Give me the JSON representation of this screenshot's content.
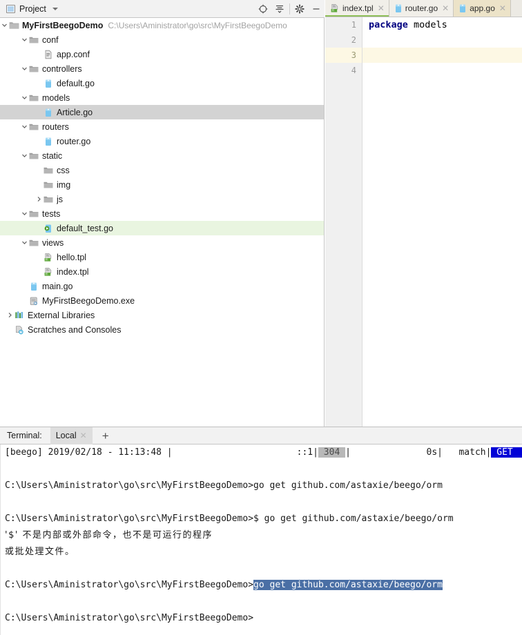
{
  "tool_window": {
    "title": "Project",
    "dropdown_icon": "chevron-down-icon",
    "actions": [
      {
        "name": "locate-target-icon",
        "label": "Select Opened File"
      },
      {
        "name": "collapse-all-icon",
        "label": "Collapse All"
      },
      {
        "name": "settings-gear-icon",
        "label": "Settings"
      },
      {
        "name": "minimize-icon",
        "label": "Hide"
      }
    ]
  },
  "tree": {
    "root_label": "MyFirstBeegoDemo",
    "root_path": "C:\\Users\\Aministrator\\go\\src\\MyFirstBeegoDemo",
    "nodes": [
      {
        "label": "conf",
        "indent": 1,
        "arrow": "expanded",
        "icon": "folder-icon",
        "state": "none"
      },
      {
        "label": "app.conf",
        "indent": 2,
        "arrow": "none",
        "icon": "config-file-icon",
        "state": "none"
      },
      {
        "label": "controllers",
        "indent": 1,
        "arrow": "expanded",
        "icon": "folder-icon",
        "state": "none"
      },
      {
        "label": "default.go",
        "indent": 2,
        "arrow": "none",
        "icon": "go-file-icon",
        "state": "none"
      },
      {
        "label": "models",
        "indent": 1,
        "arrow": "expanded",
        "icon": "folder-icon",
        "state": "none"
      },
      {
        "label": "Article.go",
        "indent": 2,
        "arrow": "none",
        "icon": "go-file-icon",
        "state": "selected"
      },
      {
        "label": "routers",
        "indent": 1,
        "arrow": "expanded",
        "icon": "folder-icon",
        "state": "none"
      },
      {
        "label": "router.go",
        "indent": 2,
        "arrow": "none",
        "icon": "go-file-icon",
        "state": "none"
      },
      {
        "label": "static",
        "indent": 1,
        "arrow": "expanded",
        "icon": "folder-icon",
        "state": "none"
      },
      {
        "label": "css",
        "indent": 2,
        "arrow": "none",
        "icon": "folder-icon",
        "state": "none"
      },
      {
        "label": "img",
        "indent": 2,
        "arrow": "none",
        "icon": "folder-icon",
        "state": "none"
      },
      {
        "label": "js",
        "indent": 2,
        "arrow": "collapsed",
        "icon": "folder-icon",
        "state": "none"
      },
      {
        "label": "tests",
        "indent": 1,
        "arrow": "expanded",
        "icon": "folder-icon",
        "state": "none"
      },
      {
        "label": "default_test.go",
        "indent": 2,
        "arrow": "none",
        "icon": "go-test-file-icon",
        "state": "running"
      },
      {
        "label": "views",
        "indent": 1,
        "arrow": "expanded",
        "icon": "folder-icon",
        "state": "none"
      },
      {
        "label": "hello.tpl",
        "indent": 2,
        "arrow": "none",
        "icon": "html-file-icon",
        "state": "none"
      },
      {
        "label": "index.tpl",
        "indent": 2,
        "arrow": "none",
        "icon": "html-file-icon",
        "state": "none"
      },
      {
        "label": "main.go",
        "indent": 1,
        "arrow": "none",
        "icon": "go-file-icon",
        "state": "none"
      },
      {
        "label": "MyFirstBeegoDemo.exe",
        "indent": 1,
        "arrow": "none",
        "icon": "exe-file-icon",
        "state": "none"
      },
      {
        "label": "External Libraries",
        "indent": 0,
        "arrow": "collapsed",
        "icon": "libraries-icon",
        "state": "none"
      },
      {
        "label": "Scratches and Consoles",
        "indent": 0,
        "arrow": "none",
        "icon": "scratches-icon",
        "state": "none"
      }
    ]
  },
  "editor": {
    "tabs": [
      {
        "label": "index.tpl",
        "icon": "html-file-icon",
        "active": false,
        "close_icon": "close-icon"
      },
      {
        "label": "router.go",
        "icon": "go-file-icon",
        "active": false,
        "close_icon": "close-icon"
      },
      {
        "label": "app.go",
        "icon": "go-file-icon",
        "active": true,
        "close_icon": "close-icon"
      }
    ],
    "line_numbers": [
      "1",
      "2",
      "3",
      "4"
    ],
    "current_line": 3,
    "code_lines": [
      {
        "keyword": "package",
        "rest": " models"
      },
      {
        "keyword": "",
        "rest": ""
      },
      {
        "keyword": "",
        "rest": ""
      },
      {
        "keyword": "",
        "rest": ""
      }
    ]
  },
  "terminal": {
    "label": "Terminal:",
    "tab_label": "Local",
    "tab_close_icon": "close-icon",
    "add_icon": "plus-icon",
    "lines": [
      {
        "type": "segments",
        "segments": [
          {
            "text": "[beego] 2019/02/18 - 11:13:48 |",
            "style": "plain"
          },
          {
            "text": "                       ::1|",
            "style": "plain"
          },
          {
            "text": " 304 ",
            "style": "hl-gray"
          },
          {
            "text": "|",
            "style": "plain"
          },
          {
            "text": "              0s|",
            "style": "plain"
          },
          {
            "text": "   match|",
            "style": "plain"
          },
          {
            "text": " GET                ",
            "style": "hl-blue"
          }
        ]
      },
      {
        "type": "blank",
        "text": ""
      },
      {
        "type": "plain",
        "text": "C:\\Users\\Aministrator\\go\\src\\MyFirstBeegoDemo>go get github.com/astaxie/beego/orm"
      },
      {
        "type": "blank",
        "text": ""
      },
      {
        "type": "plain",
        "text": "C:\\Users\\Aministrator\\go\\src\\MyFirstBeegoDemo>$ go get github.com/astaxie/beego/orm"
      },
      {
        "type": "cjk",
        "text": "'$' 不是内部或外部命令，也不是可运行的程序"
      },
      {
        "type": "cjk",
        "text": "或批处理文件。"
      },
      {
        "type": "blank",
        "text": ""
      },
      {
        "type": "segments",
        "segments": [
          {
            "text": "C:\\Users\\Aministrator\\go\\src\\MyFirstBeegoDemo>",
            "style": "plain"
          },
          {
            "text": "go get github.com/astaxie/beego/orm",
            "style": "hl-sel"
          }
        ]
      },
      {
        "type": "blank",
        "text": ""
      },
      {
        "type": "plain",
        "text": "C:\\Users\\Aministrator\\go\\src\\MyFirstBeegoDemo>"
      }
    ]
  },
  "colors": {
    "selection_gray": "#d3d3d3",
    "run_green": "#e9f5e0",
    "active_tab": "#ece3c8",
    "terminal_selection": "#4a6fa5",
    "status_get": "#0000d6",
    "keyword": "#000080",
    "current_line": "#fdf8e4"
  }
}
